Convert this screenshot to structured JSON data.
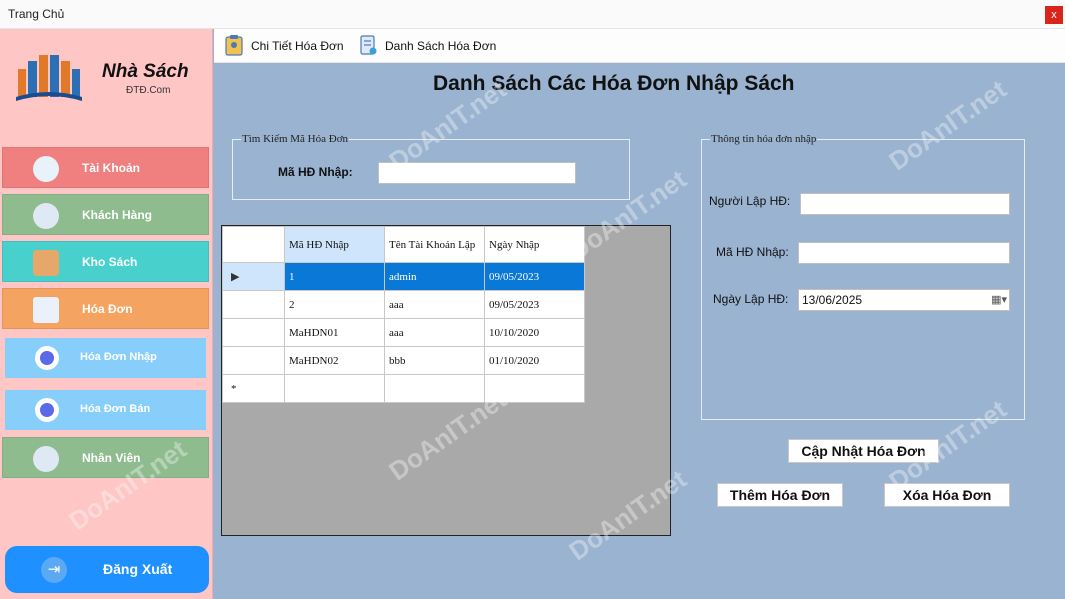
{
  "window": {
    "title": "Trang Chủ",
    "close_label": "x"
  },
  "sidebar": {
    "brand_name": "Nhà Sách",
    "brand_sub": "ĐTĐ.Com",
    "items": [
      {
        "label": "Tài Khoản",
        "color": "#f08080"
      },
      {
        "label": "Khách Hàng",
        "color": "#8fbc8f"
      },
      {
        "label": "Kho Sách",
        "color": "#48d1cc"
      },
      {
        "label": "Hóa Đơn",
        "color": "#f4a460"
      }
    ],
    "sub_items": [
      {
        "label": "Hóa Đơn Nhập"
      },
      {
        "label": "Hóa Đơn Bán"
      }
    ],
    "staff": {
      "label": "Nhân Viên",
      "color": "#8fbc8f"
    },
    "logout_label": "Đăng Xuất"
  },
  "menubar": {
    "detail_label": "Chi Tiết Hóa Đơn",
    "list_label": "Danh Sách Hóa Đơn"
  },
  "main": {
    "heading": "Danh Sách Các Hóa Đơn Nhập Sách",
    "search_group": {
      "title": "Tìm Kiếm Mã Hóa Đơn",
      "label": "Mã HĐ Nhập:",
      "value": ""
    },
    "grid": {
      "columns": [
        "Mã HĐ Nhập",
        "Tên Tài Khoản Lập",
        "Ngày Nhập"
      ],
      "rows": [
        [
          "1",
          "admin",
          "09/05/2023"
        ],
        [
          "2",
          "aaa",
          "09/05/2023"
        ],
        [
          "MaHDN01",
          "aaa",
          "10/10/2020"
        ],
        [
          "MaHDN02",
          "bbb",
          "01/10/2020"
        ]
      ],
      "new_row_marker": "*",
      "current_row_marker": "▶"
    },
    "info_group": {
      "title": "Thông tin hóa đơn nhập",
      "creator_label": "Người Lập HĐ:",
      "creator_value": "",
      "id_label": "Mã HĐ Nhập:",
      "id_value": "",
      "date_label": "Ngày Lập HĐ:",
      "date_value": "13/06/2025"
    },
    "buttons": {
      "update": "Cập Nhật Hóa Đơn",
      "add": "Thêm Hóa Đơn",
      "delete": "Xóa Hóa Đơn"
    }
  },
  "watermark": "DoAnIT.net"
}
